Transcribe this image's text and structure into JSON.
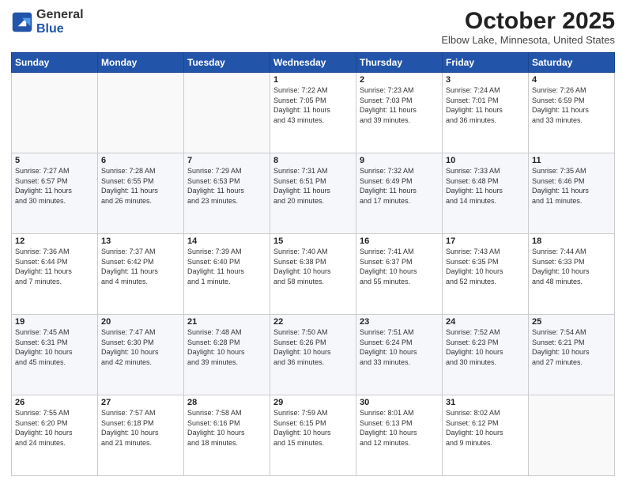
{
  "header": {
    "logo_general": "General",
    "logo_blue": "Blue",
    "month_title": "October 2025",
    "location": "Elbow Lake, Minnesota, United States"
  },
  "days_of_week": [
    "Sunday",
    "Monday",
    "Tuesday",
    "Wednesday",
    "Thursday",
    "Friday",
    "Saturday"
  ],
  "weeks": [
    [
      {
        "day": "",
        "info": ""
      },
      {
        "day": "",
        "info": ""
      },
      {
        "day": "",
        "info": ""
      },
      {
        "day": "1",
        "info": "Sunrise: 7:22 AM\nSunset: 7:05 PM\nDaylight: 11 hours\nand 43 minutes."
      },
      {
        "day": "2",
        "info": "Sunrise: 7:23 AM\nSunset: 7:03 PM\nDaylight: 11 hours\nand 39 minutes."
      },
      {
        "day": "3",
        "info": "Sunrise: 7:24 AM\nSunset: 7:01 PM\nDaylight: 11 hours\nand 36 minutes."
      },
      {
        "day": "4",
        "info": "Sunrise: 7:26 AM\nSunset: 6:59 PM\nDaylight: 11 hours\nand 33 minutes."
      }
    ],
    [
      {
        "day": "5",
        "info": "Sunrise: 7:27 AM\nSunset: 6:57 PM\nDaylight: 11 hours\nand 30 minutes."
      },
      {
        "day": "6",
        "info": "Sunrise: 7:28 AM\nSunset: 6:55 PM\nDaylight: 11 hours\nand 26 minutes."
      },
      {
        "day": "7",
        "info": "Sunrise: 7:29 AM\nSunset: 6:53 PM\nDaylight: 11 hours\nand 23 minutes."
      },
      {
        "day": "8",
        "info": "Sunrise: 7:31 AM\nSunset: 6:51 PM\nDaylight: 11 hours\nand 20 minutes."
      },
      {
        "day": "9",
        "info": "Sunrise: 7:32 AM\nSunset: 6:49 PM\nDaylight: 11 hours\nand 17 minutes."
      },
      {
        "day": "10",
        "info": "Sunrise: 7:33 AM\nSunset: 6:48 PM\nDaylight: 11 hours\nand 14 minutes."
      },
      {
        "day": "11",
        "info": "Sunrise: 7:35 AM\nSunset: 6:46 PM\nDaylight: 11 hours\nand 11 minutes."
      }
    ],
    [
      {
        "day": "12",
        "info": "Sunrise: 7:36 AM\nSunset: 6:44 PM\nDaylight: 11 hours\nand 7 minutes."
      },
      {
        "day": "13",
        "info": "Sunrise: 7:37 AM\nSunset: 6:42 PM\nDaylight: 11 hours\nand 4 minutes."
      },
      {
        "day": "14",
        "info": "Sunrise: 7:39 AM\nSunset: 6:40 PM\nDaylight: 11 hours\nand 1 minute."
      },
      {
        "day": "15",
        "info": "Sunrise: 7:40 AM\nSunset: 6:38 PM\nDaylight: 10 hours\nand 58 minutes."
      },
      {
        "day": "16",
        "info": "Sunrise: 7:41 AM\nSunset: 6:37 PM\nDaylight: 10 hours\nand 55 minutes."
      },
      {
        "day": "17",
        "info": "Sunrise: 7:43 AM\nSunset: 6:35 PM\nDaylight: 10 hours\nand 52 minutes."
      },
      {
        "day": "18",
        "info": "Sunrise: 7:44 AM\nSunset: 6:33 PM\nDaylight: 10 hours\nand 48 minutes."
      }
    ],
    [
      {
        "day": "19",
        "info": "Sunrise: 7:45 AM\nSunset: 6:31 PM\nDaylight: 10 hours\nand 45 minutes."
      },
      {
        "day": "20",
        "info": "Sunrise: 7:47 AM\nSunset: 6:30 PM\nDaylight: 10 hours\nand 42 minutes."
      },
      {
        "day": "21",
        "info": "Sunrise: 7:48 AM\nSunset: 6:28 PM\nDaylight: 10 hours\nand 39 minutes."
      },
      {
        "day": "22",
        "info": "Sunrise: 7:50 AM\nSunset: 6:26 PM\nDaylight: 10 hours\nand 36 minutes."
      },
      {
        "day": "23",
        "info": "Sunrise: 7:51 AM\nSunset: 6:24 PM\nDaylight: 10 hours\nand 33 minutes."
      },
      {
        "day": "24",
        "info": "Sunrise: 7:52 AM\nSunset: 6:23 PM\nDaylight: 10 hours\nand 30 minutes."
      },
      {
        "day": "25",
        "info": "Sunrise: 7:54 AM\nSunset: 6:21 PM\nDaylight: 10 hours\nand 27 minutes."
      }
    ],
    [
      {
        "day": "26",
        "info": "Sunrise: 7:55 AM\nSunset: 6:20 PM\nDaylight: 10 hours\nand 24 minutes."
      },
      {
        "day": "27",
        "info": "Sunrise: 7:57 AM\nSunset: 6:18 PM\nDaylight: 10 hours\nand 21 minutes."
      },
      {
        "day": "28",
        "info": "Sunrise: 7:58 AM\nSunset: 6:16 PM\nDaylight: 10 hours\nand 18 minutes."
      },
      {
        "day": "29",
        "info": "Sunrise: 7:59 AM\nSunset: 6:15 PM\nDaylight: 10 hours\nand 15 minutes."
      },
      {
        "day": "30",
        "info": "Sunrise: 8:01 AM\nSunset: 6:13 PM\nDaylight: 10 hours\nand 12 minutes."
      },
      {
        "day": "31",
        "info": "Sunrise: 8:02 AM\nSunset: 6:12 PM\nDaylight: 10 hours\nand 9 minutes."
      },
      {
        "day": "",
        "info": ""
      }
    ]
  ]
}
